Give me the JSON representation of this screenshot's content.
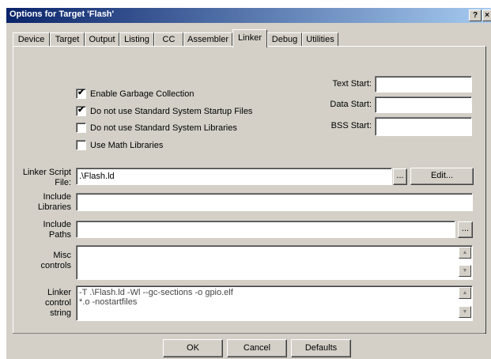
{
  "window": {
    "title": "Options for Target 'Flash'",
    "help_glyph": "?",
    "close_glyph": "×"
  },
  "tabs": [
    {
      "label": "Device",
      "active": false
    },
    {
      "label": "Target",
      "active": false
    },
    {
      "label": "Output",
      "active": false
    },
    {
      "label": "Listing",
      "active": false
    },
    {
      "label": "CC",
      "active": false
    },
    {
      "label": "Assembler",
      "active": false
    },
    {
      "label": "Linker",
      "active": true
    },
    {
      "label": "Debug",
      "active": false
    },
    {
      "label": "Utilities",
      "active": false
    }
  ],
  "options": [
    {
      "label": "Enable Garbage Collection",
      "checked": true
    },
    {
      "label": "Do not use Standard System Startup Files",
      "checked": true
    },
    {
      "label": "Do not use Standard System Libraries",
      "checked": false
    },
    {
      "label": "Use Math Libraries",
      "checked": false
    }
  ],
  "sections": {
    "text_start": {
      "label": "Text Start:",
      "value": ""
    },
    "data_start": {
      "label": "Data Start:",
      "value": ""
    },
    "bss_start": {
      "label": "BSS Start:",
      "value": ""
    }
  },
  "linker_script": {
    "label_line1": "Linker Script",
    "label_line2": "File:",
    "value": ".\\Flash.ld",
    "browse": "...",
    "edit": "Edit..."
  },
  "include_libraries": {
    "label_line1": "Include",
    "label_line2": "Libraries",
    "value": ""
  },
  "include_paths": {
    "label_line1": "Include",
    "label_line2": "Paths",
    "value": "",
    "browse": "..."
  },
  "misc_controls": {
    "label_line1": "Misc",
    "label_line2": "controls",
    "value": ""
  },
  "linker_control_string": {
    "label_line1": "Linker",
    "label_line2": "control",
    "label_line3": "string",
    "value": "-T .\\Flash.ld -Wl --gc-sections -o gpio.elf\n*.o -nostartfiles"
  },
  "buttons": {
    "ok": "OK",
    "cancel": "Cancel",
    "defaults": "Defaults"
  },
  "scroll_glyphs": {
    "up": "▲",
    "down": "▼"
  },
  "check_glyph": "✔"
}
